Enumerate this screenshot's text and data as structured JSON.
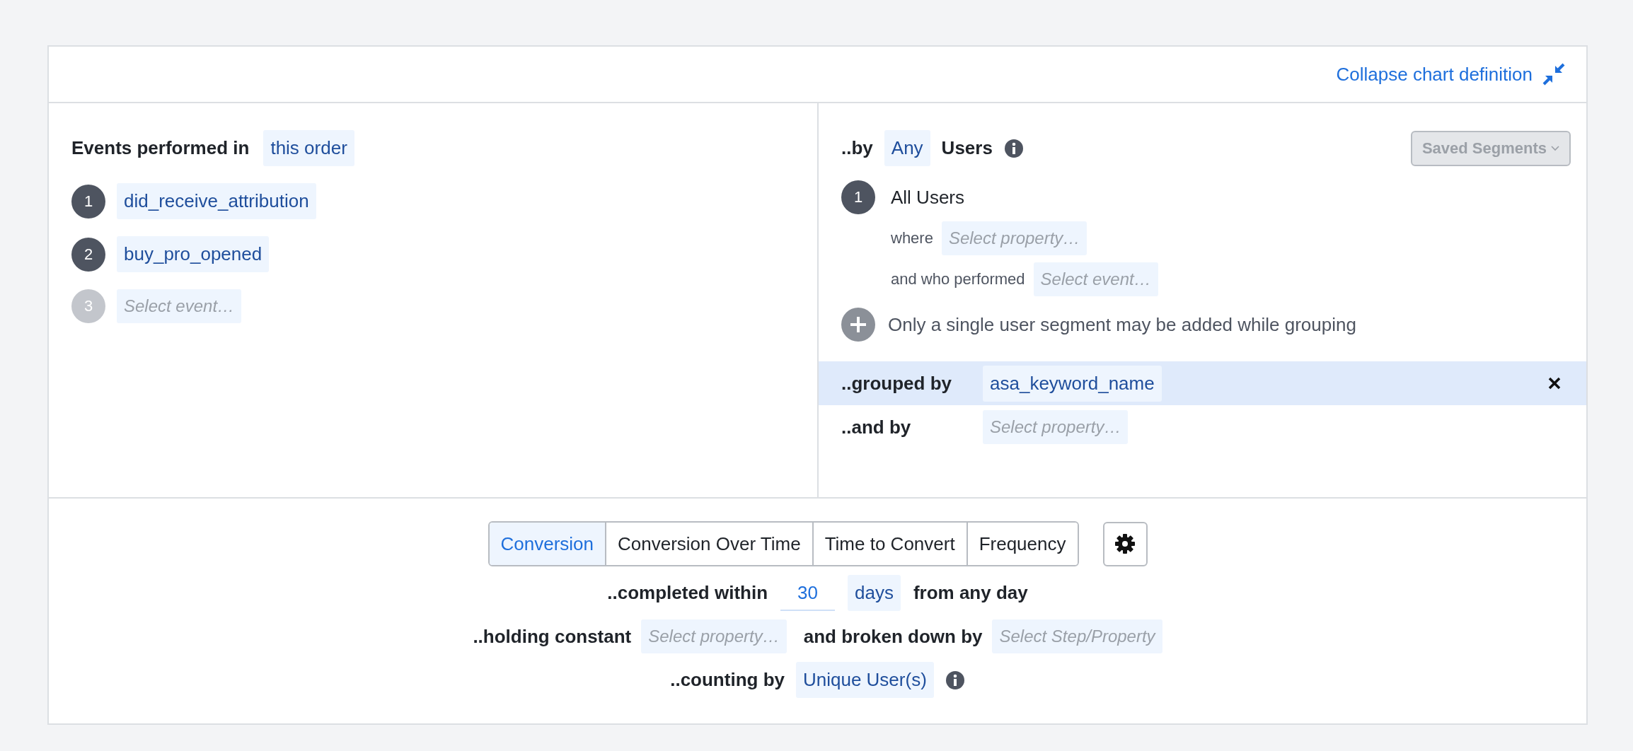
{
  "header": {
    "collapse_link": "Collapse chart definition"
  },
  "events": {
    "label": "Events performed in",
    "order": "this order",
    "steps": [
      {
        "number": "1",
        "kind": "event",
        "text": "did_receive_attribution"
      },
      {
        "number": "2",
        "kind": "event",
        "text": "buy_pro_opened"
      },
      {
        "number": "3",
        "kind": "empty",
        "text": "Select event…"
      }
    ]
  },
  "segments": {
    "by_label": "..by",
    "scope": "Any",
    "users_label": "Users",
    "saved_segments": {
      "label": "Saved Segments",
      "disabled": true
    },
    "items": [
      {
        "number": "1",
        "name": "All Users",
        "where_label": "where",
        "where_placeholder": "Select property…",
        "performed_label": "and who performed",
        "performed_placeholder": "Select event…"
      }
    ],
    "add_note": "Only a single user segment may be added while grouping"
  },
  "grouping": [
    {
      "label": "..grouped by",
      "kind": "value",
      "text": "asa_keyword_name",
      "highlighted": true
    },
    {
      "label": "..and by",
      "kind": "empty",
      "text": "Select property…",
      "highlighted": false
    }
  ],
  "chart_types": [
    {
      "label": "Conversion",
      "selected": true
    },
    {
      "label": "Conversion Over Time",
      "selected": false
    },
    {
      "label": "Time to Convert",
      "selected": false
    },
    {
      "label": "Frequency",
      "selected": false
    }
  ],
  "completed": {
    "label": "..completed within",
    "value": "30",
    "unit": "days",
    "suffix": "from any day"
  },
  "holding": {
    "label": "..holding constant",
    "placeholder": "Select property…",
    "breakdown_label": "and broken down by",
    "breakdown_placeholder": "Select Step/Property"
  },
  "counting": {
    "label": "..counting by",
    "value": "Unique User(s)"
  }
}
